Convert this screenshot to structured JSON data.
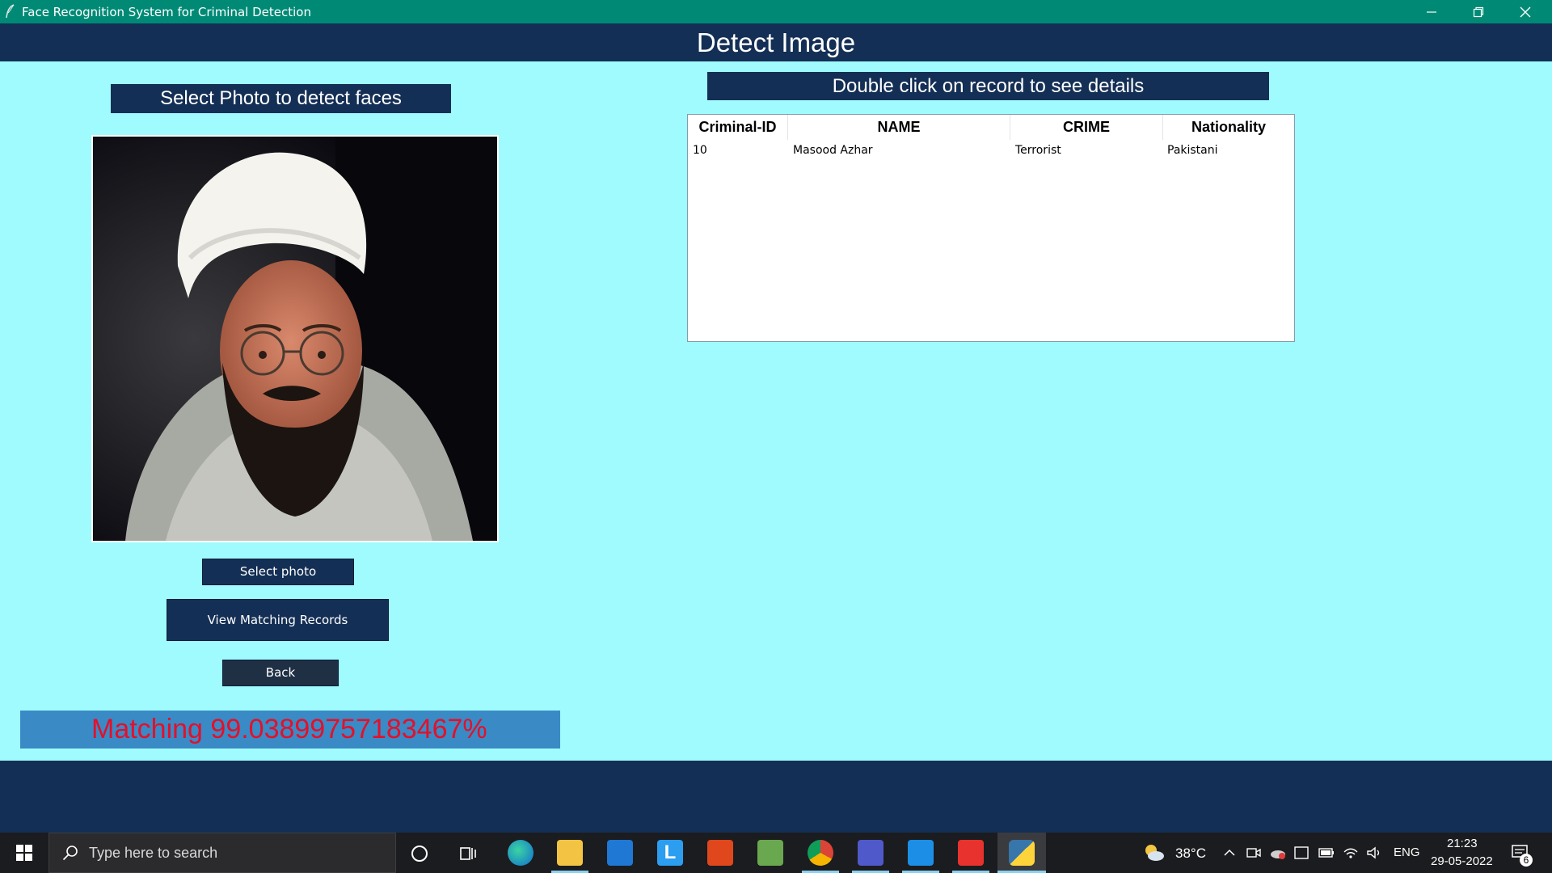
{
  "window": {
    "title": "Face Recognition System for Criminal Detection",
    "controls": {
      "minimize": "minimize",
      "restore": "restore",
      "close": "close"
    }
  },
  "header": {
    "title": "Detect Image"
  },
  "left_panel": {
    "select_label": "Select Photo to detect faces",
    "buttons": {
      "select_photo": "Select photo",
      "view_matching": "View Matching Records",
      "back": "Back"
    },
    "matching_text": "Matching 99.03899757183467%"
  },
  "right_panel": {
    "records_label": "Double click on record to see details",
    "table": {
      "columns": [
        "Criminal-ID",
        "NAME",
        "CRIME",
        "Nationality"
      ],
      "rows": [
        {
          "id": "10",
          "name": "Masood Azhar",
          "crime": "Terrorist",
          "nationality": "Pakistani"
        }
      ]
    }
  },
  "taskbar": {
    "search_placeholder": "Type here to search",
    "weather_temp": "38°C",
    "language": "ENG",
    "time": "21:23",
    "date": "29-05-2022",
    "notification_count": "6"
  },
  "colors": {
    "background": "#9ffbfd",
    "title_bar": "#008a76",
    "header": "#142f55",
    "matching_bar": "#3a8ac6",
    "matching_text": "#e3102a"
  }
}
